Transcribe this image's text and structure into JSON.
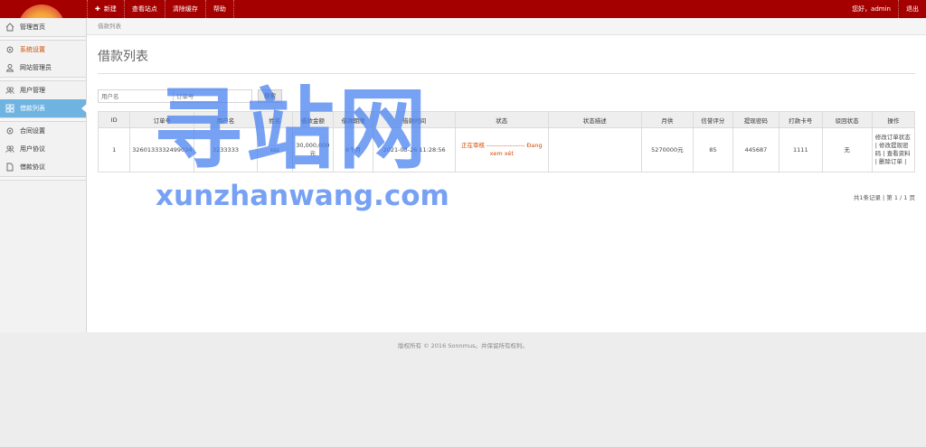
{
  "topbar": {
    "nav": [
      {
        "label": "新建",
        "icon": "plus-icon"
      },
      {
        "label": "查看站点"
      },
      {
        "label": "清除缓存"
      },
      {
        "label": "帮助"
      }
    ],
    "greeting": "您好，admin",
    "logout": "退出"
  },
  "sidebar": {
    "items": [
      {
        "label": "管理首页",
        "icon": "home-icon"
      },
      {
        "label": "系统设置",
        "icon": "gear-icon"
      },
      {
        "label": "网站管理员",
        "icon": "user-icon"
      },
      {
        "label": "用户管理",
        "icon": "users-icon"
      },
      {
        "label": "借款列表",
        "icon": "grid-icon"
      },
      {
        "label": "合同设置",
        "icon": "gear-icon"
      },
      {
        "label": "用户协议",
        "icon": "users-icon"
      },
      {
        "label": "借款协议",
        "icon": "document-icon"
      }
    ]
  },
  "breadcrumb": "借款列表",
  "page_title": "借款列表",
  "search": {
    "username_placeholder": "用户名",
    "order_placeholder": "订单号",
    "button": "搜索"
  },
  "table": {
    "headers": [
      "ID",
      "订单号",
      "用户名",
      "姓名",
      "借款金额",
      "借款期限",
      "借款时间",
      "状态",
      "状态描述",
      "月供",
      "信誉评分",
      "提现密码",
      "打款卡号",
      "驳回状态",
      "操作"
    ],
    "rows": [
      {
        "id": "1",
        "order": "3260133332499034",
        "username": "3233333",
        "name": "sss",
        "amount": "30,000,000 元",
        "term": "6个月",
        "time": "2021-03-26 11:28:56",
        "status": "正在审核 ------------------ Đang xem xét",
        "status_desc": "",
        "monthly": "5270000元",
        "credit": "85",
        "withdraw_pwd": "445687",
        "card": "1111",
        "reject": "无",
        "ops": "修改订单状态 | 修改提现密码 | 查看资料 | 删除订单 |"
      }
    ]
  },
  "pager": "共1条记录 | 第 1 / 1 页",
  "footer": "版权所有 © 2016 Sonnmus。并保留所有权利。",
  "watermark": {
    "cn": "寻站网",
    "en": "xunzhanwang.com"
  },
  "colors": {
    "topbar": "#a50000",
    "active": "#6fb3e0",
    "accent": "#d14b00",
    "watermark": "#4a82f0"
  }
}
